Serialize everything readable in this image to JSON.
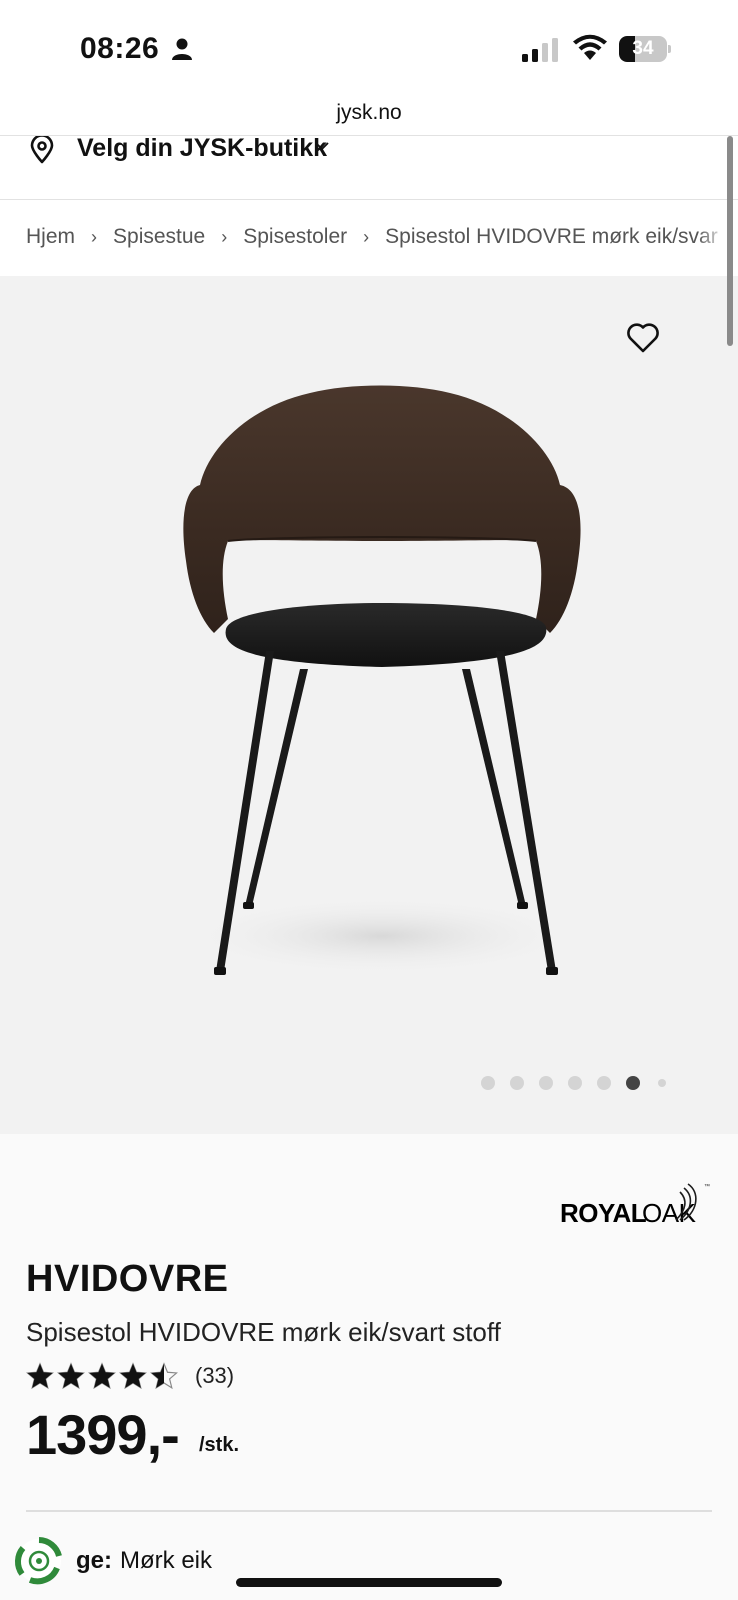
{
  "status_bar": {
    "time": "08:26",
    "battery": "34",
    "battery_level": 0.34
  },
  "browser": {
    "url": "jysk.no"
  },
  "store_selector": {
    "label": "Velg din JYSK-butikk"
  },
  "breadcrumb": {
    "items": [
      "Hjem",
      "Spisestue",
      "Spisestoler",
      "Spisestol HVIDOVRE mørk eik/svar"
    ],
    "separator": "›"
  },
  "gallery": {
    "image_count": 7,
    "active_index": 5
  },
  "product": {
    "brand_part1": "ROYAL",
    "brand_part2": "OAK",
    "brand_tm": "™",
    "name": "HVIDOVRE",
    "description": "Spisestol HVIDOVRE mørk eik/svart stoff",
    "rating": 4.5,
    "rating_count": "(33)",
    "price": "1399,-",
    "price_unit": "/stk.",
    "color_key": "ge:",
    "color_value": "Mørk eik"
  },
  "colors": {
    "accent": "#111111",
    "gallery_bg": "#f2f2f2",
    "dot_active": "#444444",
    "dot_inactive": "#d4d4d4"
  }
}
